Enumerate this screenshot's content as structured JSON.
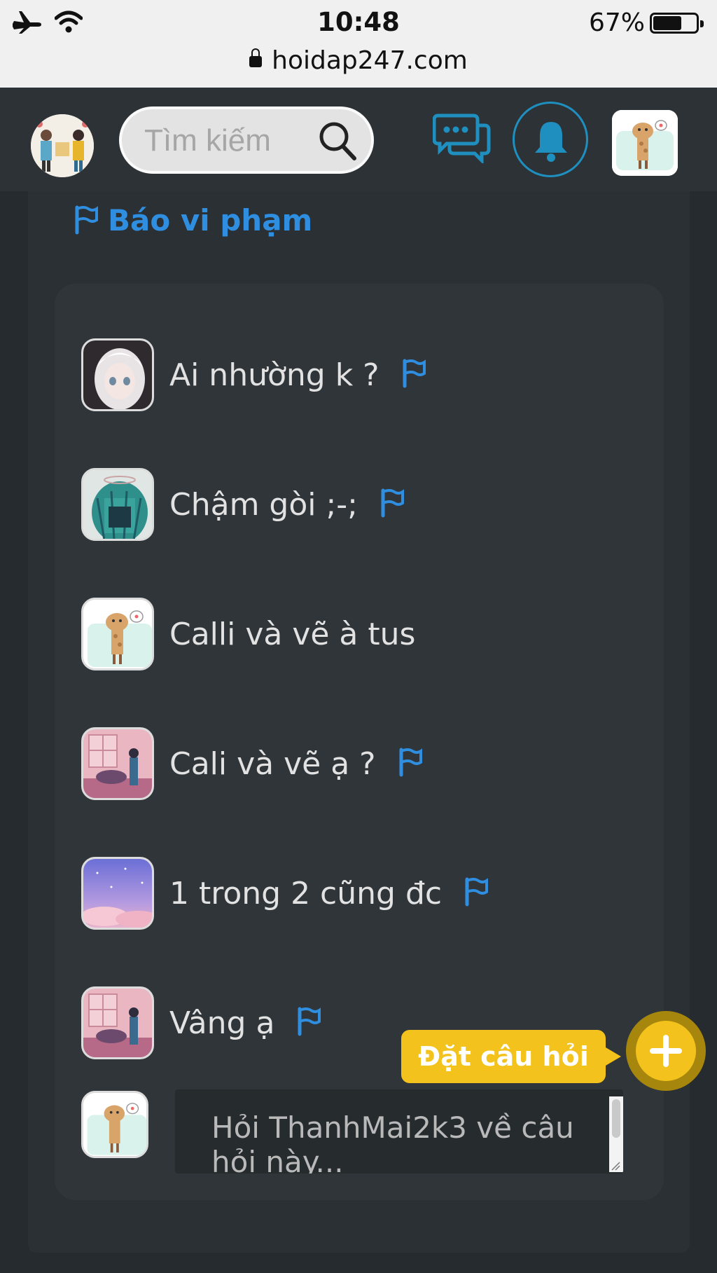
{
  "status_bar": {
    "time": "10:48",
    "battery_percent": "67%",
    "battery_level": 0.67,
    "url": "hoidap247.com"
  },
  "header": {
    "search_placeholder": "Tìm kiếm"
  },
  "report": {
    "label": "Báo vi phạm"
  },
  "comments": [
    {
      "text": "Ai nhường k ?",
      "flag": true,
      "avatar": "anime-girl-white-hair"
    },
    {
      "text": "Chậm gòi ;-;",
      "flag": true,
      "avatar": "anime-girl-green-hair"
    },
    {
      "text": "Calli và vẽ à tus",
      "flag": false,
      "avatar": "giraffe"
    },
    {
      "text": "Cali và vẽ ạ ?",
      "flag": true,
      "avatar": "pink-room"
    },
    {
      "text": "1 trong 2 cũng đc",
      "flag": true,
      "avatar": "purple-sky"
    },
    {
      "text": "Vâng ạ",
      "flag": true,
      "avatar": "pink-room"
    }
  ],
  "composer": {
    "placeholder": "Hỏi ThanhMai2k3 về câu hỏi này..."
  },
  "ask_button": {
    "label": "Đặt câu hỏi"
  },
  "colors": {
    "accent_blue": "#2f8ee0",
    "ask_yellow": "#f3c21c",
    "background": "#252b2f"
  }
}
